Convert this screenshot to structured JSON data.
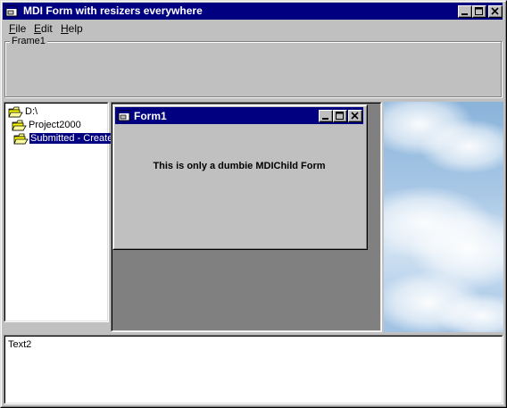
{
  "window": {
    "title": "MDI Form with resizers everywhere"
  },
  "menu": {
    "file": {
      "hotkey": "F",
      "rest": "ile"
    },
    "edit": {
      "hotkey": "E",
      "rest": "dit"
    },
    "help": {
      "hotkey": "H",
      "rest": "elp"
    }
  },
  "frame": {
    "label": "Frame1"
  },
  "tree": {
    "items": [
      {
        "label": "D:\\"
      },
      {
        "label": "Project2000"
      },
      {
        "label": "Submitted - Create",
        "selected": true
      }
    ]
  },
  "child_form": {
    "title": "Form1",
    "body_text": "This is only a dumbie MDIChild Form"
  },
  "text2": {
    "value": "Text2"
  },
  "colors": {
    "titlebar": "#000080",
    "face": "#c0c0c0",
    "mdi_background": "#808080",
    "selection": "#000080"
  },
  "icons": [
    "app-icon",
    "minimize-icon",
    "maximize-icon",
    "close-icon",
    "folder-icon",
    "open-folder-icon"
  ]
}
